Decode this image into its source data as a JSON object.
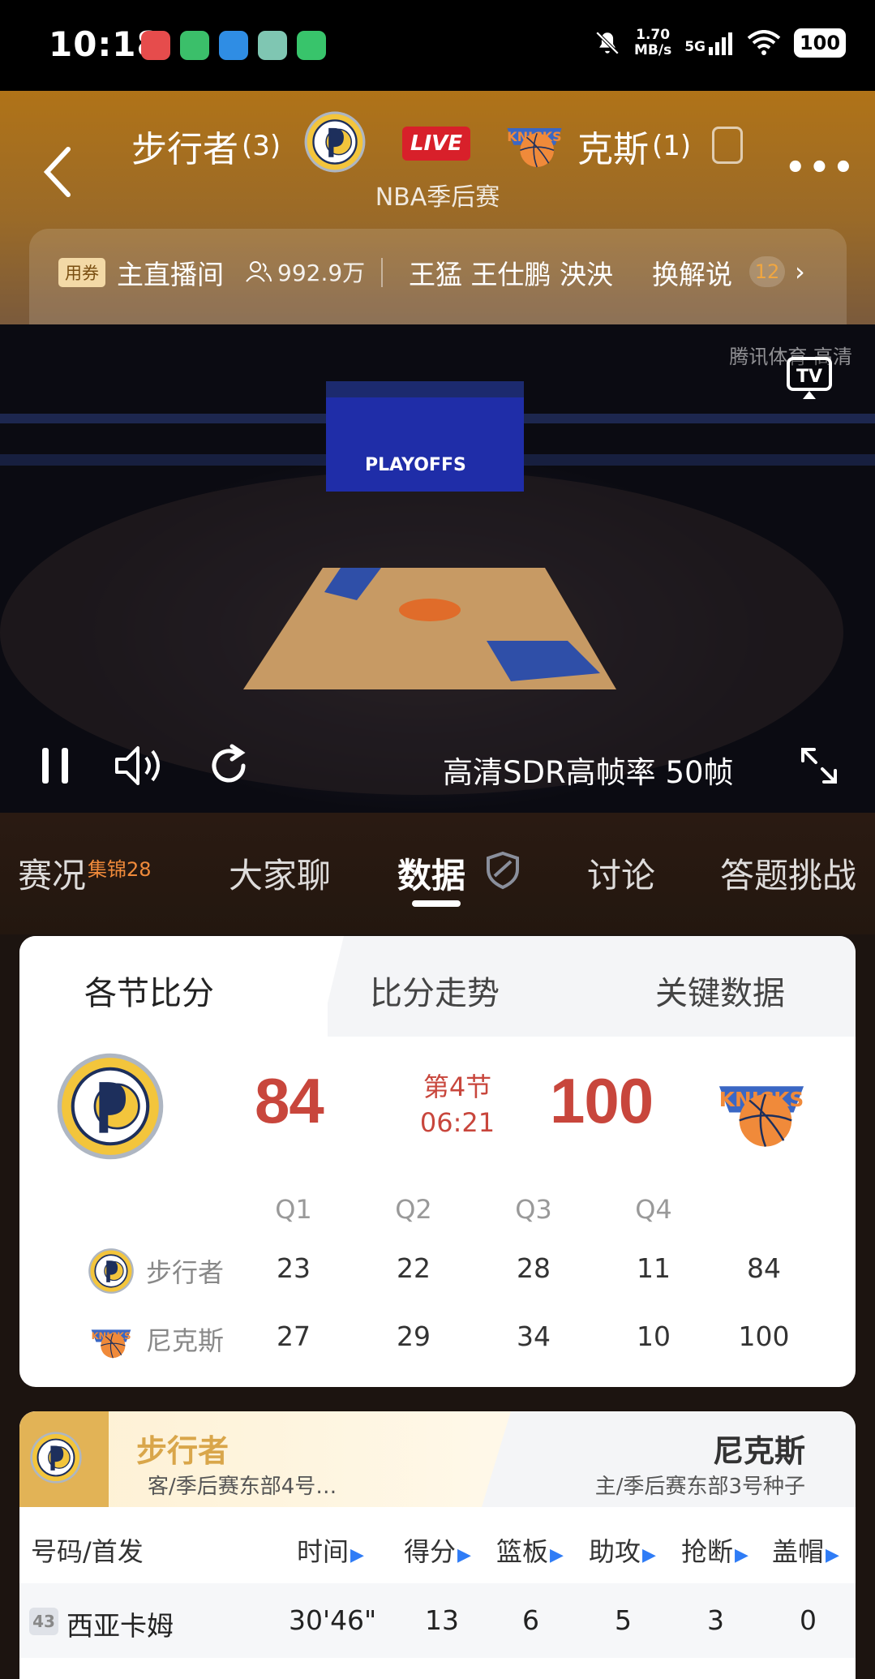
{
  "status_bar": {
    "time": "10:18",
    "net_speed_value": "1.70",
    "net_speed_unit": "MB/s",
    "network": "5G",
    "battery": "100"
  },
  "header": {
    "home_team": "步行者",
    "home_series": "(3)",
    "away_team": "克斯",
    "away_series": "(1)",
    "live": "LIVE",
    "subtitle": "NBA季后赛"
  },
  "commentary": {
    "coupon": "用券",
    "main_room": "主直播间",
    "viewers": "992.9万",
    "commentators": "王猛 王仕鹏 泱泱",
    "switch_label": "换解说",
    "count": "12"
  },
  "video": {
    "watermark": "腾讯体育 高清",
    "quality": "高清SDR高帧率 50帧"
  },
  "tabs": [
    {
      "label": "赛况",
      "badge": "集锦28"
    },
    {
      "label": "大家聊"
    },
    {
      "label": "数据"
    },
    {
      "label": "讨论"
    },
    {
      "label": "答题挑战"
    }
  ],
  "score_card": {
    "subtabs": [
      "各节比分",
      "比分走势",
      "关键数据"
    ],
    "home_score": "84",
    "away_score": "100",
    "period": "第4节",
    "clock": "06:21",
    "quarters": [
      "Q1",
      "Q2",
      "Q3",
      "Q4"
    ],
    "rows": [
      {
        "team": "步行者",
        "q": [
          "23",
          "22",
          "28",
          "11"
        ],
        "total": "84"
      },
      {
        "team": "尼克斯",
        "q": [
          "27",
          "29",
          "34",
          "10"
        ],
        "total": "100"
      }
    ]
  },
  "stats": {
    "home_name": "步行者",
    "home_sub": "客/季后赛东部4号…",
    "away_name": "尼克斯",
    "away_sub": "主/季后赛东部3号种子",
    "columns": [
      "号码/首发",
      "时间",
      "得分",
      "篮板",
      "助攻",
      "抢断",
      "盖帽"
    ],
    "player": {
      "number": "43",
      "name": "西亚卡姆",
      "time": "30'46\"",
      "points": "13",
      "rebounds": "6",
      "assists": "5",
      "steals": "3",
      "blocks": "0"
    }
  },
  "colors": {
    "score_red": "#c8463c",
    "header_gold": "#b07318",
    "pacers_gold": "#e2b356",
    "knicks_orange": "#f08a3a",
    "knicks_blue": "#3a67c4"
  }
}
